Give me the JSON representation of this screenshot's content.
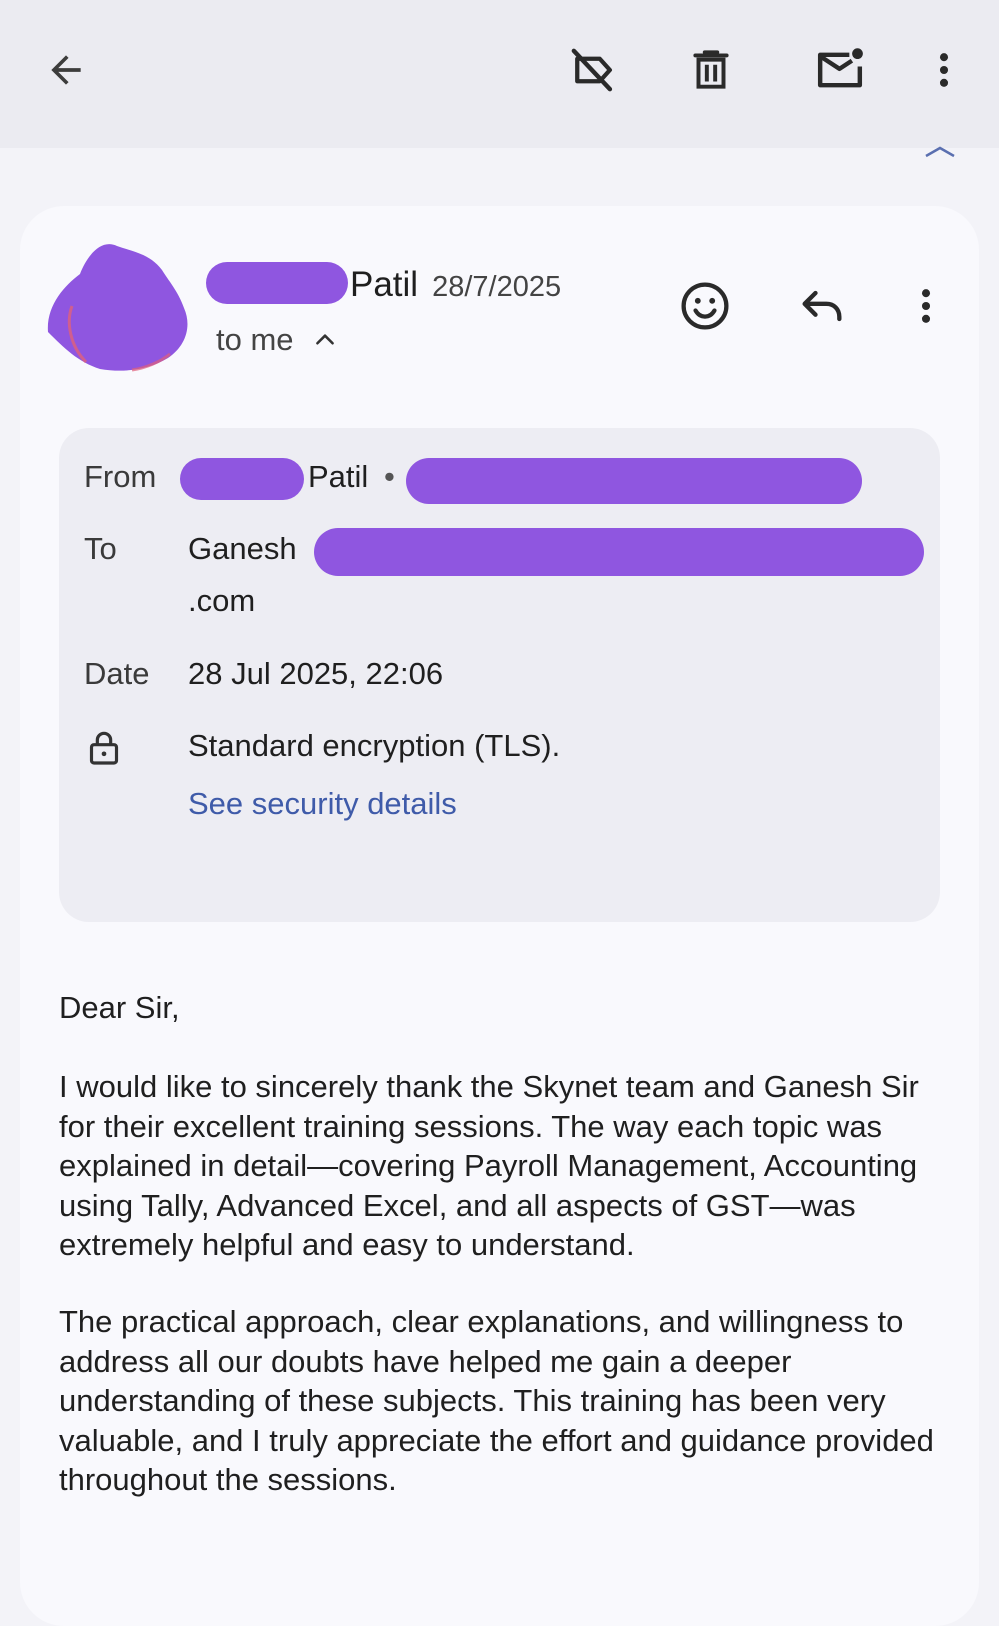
{
  "toolbar": {
    "back_icon": "arrow-left-icon",
    "label_off_icon": "label-off-icon",
    "delete_icon": "trash-icon",
    "mark_unread_icon": "mail-unread-icon",
    "more_icon": "more-vert-icon"
  },
  "message": {
    "sender_name": "Patil",
    "date_short": "28/7/2025",
    "to_summary": "to me",
    "details": {
      "from_label": "From",
      "from_name": "Patil",
      "from_separator": "•",
      "to_label": "To",
      "to_name": "Ganesh",
      "to_continuation": ".com",
      "date_label": "Date",
      "date_value": "28 Jul 2025, 22:06",
      "encryption_text": "Standard encryption (TLS).",
      "security_link": "See security details"
    },
    "body": {
      "greeting": "Dear Sir,",
      "paragraph1": "I would like to sincerely thank the Skynet team and Ganesh Sir for their excellent training sessions. The way each topic was explained in detail—covering Payroll Management, Accounting using Tally, Advanced Excel, and all aspects of GST—was extremely helpful and easy to understand.",
      "paragraph2": "The practical approach, clear explanations, and willingness to address all our doubts have helped me gain a deeper understanding of these subjects. This training has been very valuable, and I truly appreciate the effort and guidance provided throughout the sessions."
    }
  },
  "colors": {
    "redaction": "#8f56e0",
    "link": "#3f5ba9",
    "toolbar_bg": "#ebebf1",
    "card_bg": "#f9f9fd",
    "details_bg": "#ededf3"
  }
}
